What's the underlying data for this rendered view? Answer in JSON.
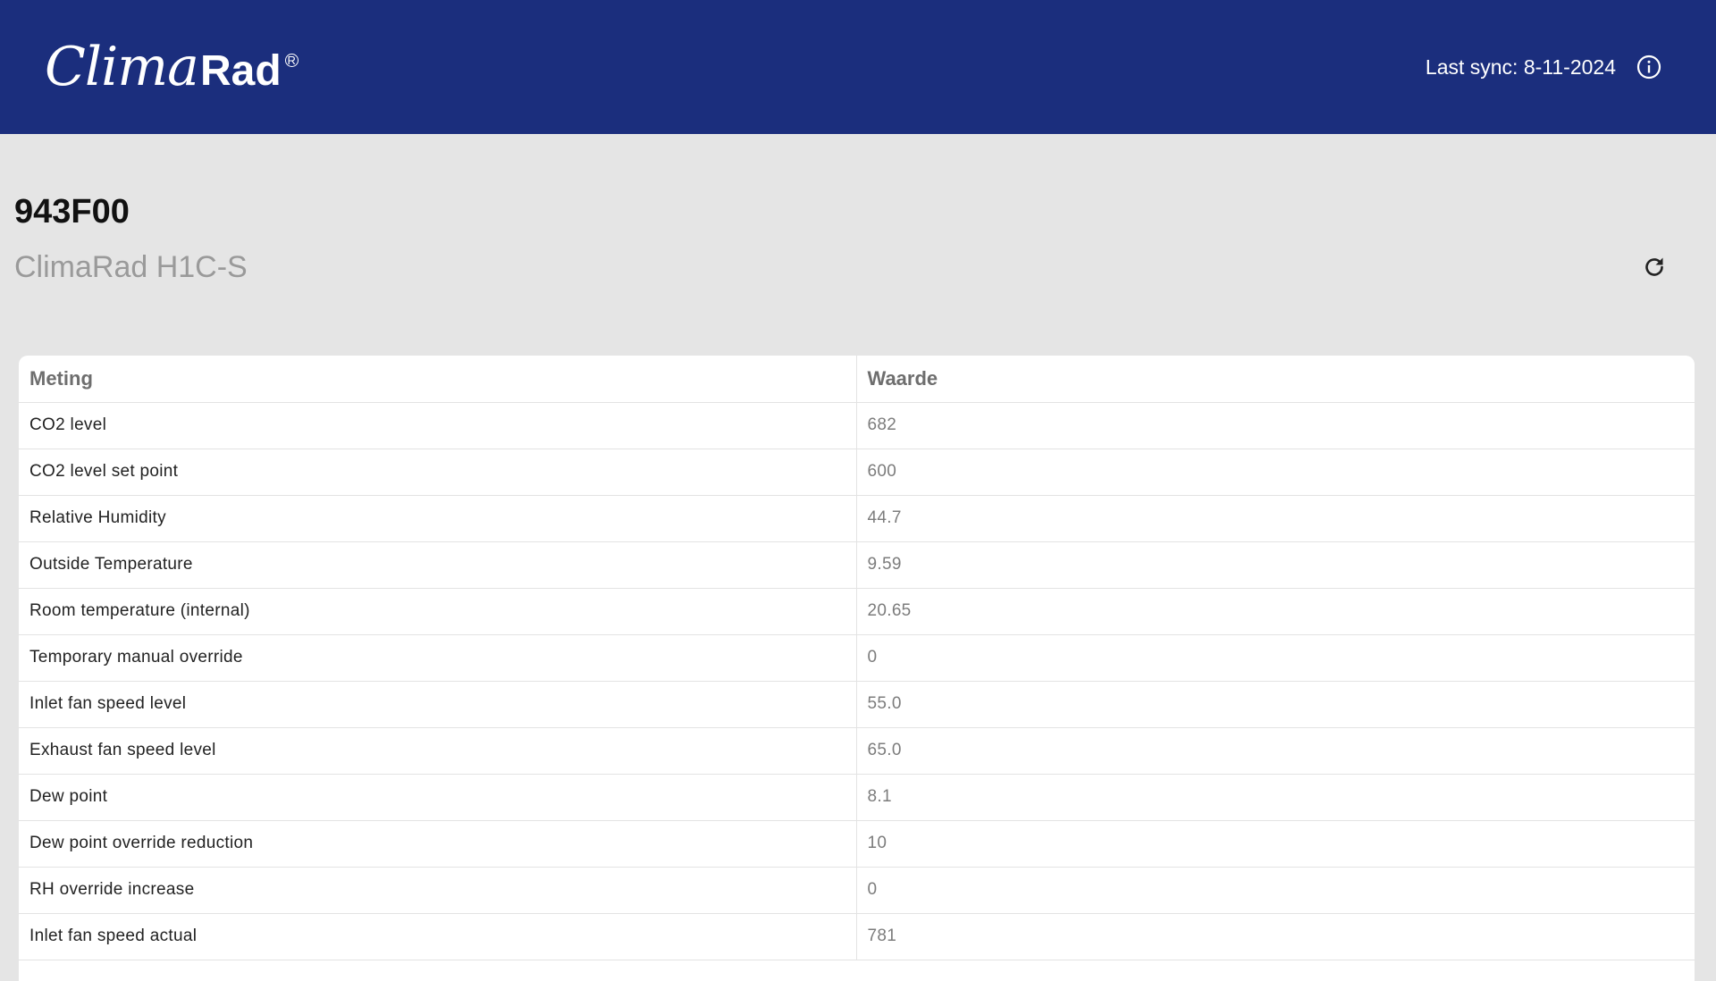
{
  "header": {
    "logo_script": "Clima",
    "logo_sans": "Rad",
    "logo_reg": "R",
    "sync_text": "Last sync: 8-11-2024",
    "info_icon": "info-circle-icon"
  },
  "device": {
    "id": "943F00",
    "model": "ClimaRad H1C-S",
    "refresh_icon": "refresh-icon"
  },
  "table": {
    "headers": [
      "Meting",
      "Waarde"
    ],
    "rows": [
      {
        "label": "CO2 level",
        "value": "682"
      },
      {
        "label": "CO2 level set point",
        "value": "600"
      },
      {
        "label": "Relative Humidity",
        "value": "44.7"
      },
      {
        "label": "Outside Temperature",
        "value": "9.59"
      },
      {
        "label": "Room temperature (internal)",
        "value": "20.65"
      },
      {
        "label": "Temporary manual override",
        "value": "0"
      },
      {
        "label": "Inlet fan speed level",
        "value": "55.0"
      },
      {
        "label": "Exhaust fan speed level",
        "value": "65.0"
      },
      {
        "label": "Dew point",
        "value": "8.1"
      },
      {
        "label": "Dew point override reduction",
        "value": "10"
      },
      {
        "label": "RH override increase",
        "value": "0"
      },
      {
        "label": "Inlet fan speed actual",
        "value": "781"
      }
    ]
  },
  "colors": {
    "header_bg": "#1b2e7d",
    "page_bg": "#e5e5e5",
    "card_bg": "#ffffff"
  }
}
